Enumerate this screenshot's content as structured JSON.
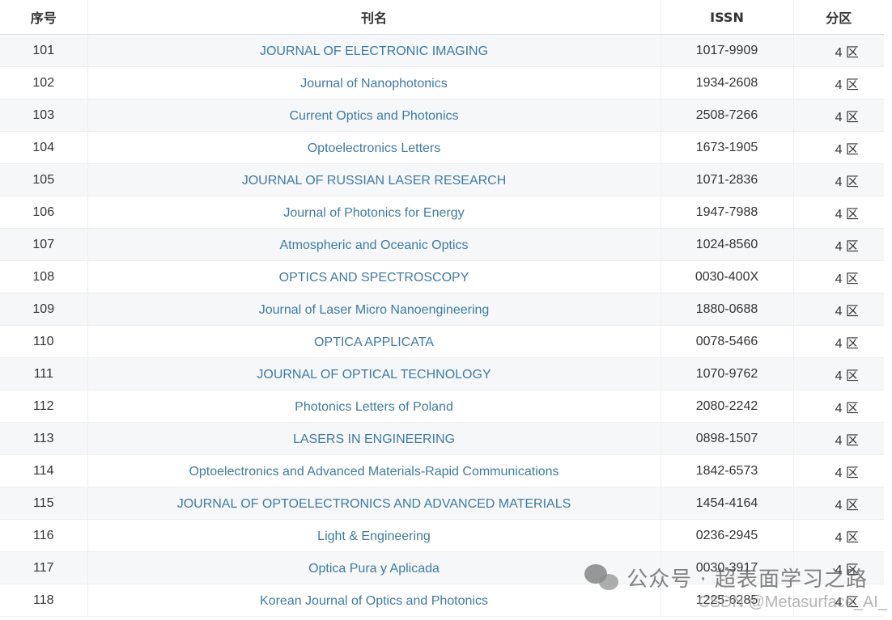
{
  "headers": [
    "序号",
    "刊名",
    "ISSN",
    "分区"
  ],
  "rows": [
    {
      "num": "101",
      "name": "JOURNAL OF ELECTRONIC IMAGING",
      "issn": "1017-9909",
      "zone": "4 区"
    },
    {
      "num": "102",
      "name": "Journal of Nanophotonics",
      "issn": "1934-2608",
      "zone": "4 区"
    },
    {
      "num": "103",
      "name": "Current Optics and Photonics",
      "issn": "2508-7266",
      "zone": "4 区"
    },
    {
      "num": "104",
      "name": "Optoelectronics Letters",
      "issn": "1673-1905",
      "zone": "4 区"
    },
    {
      "num": "105",
      "name": "JOURNAL OF RUSSIAN LASER RESEARCH",
      "issn": "1071-2836",
      "zone": "4 区"
    },
    {
      "num": "106",
      "name": "Journal of Photonics for Energy",
      "issn": "1947-7988",
      "zone": "4 区"
    },
    {
      "num": "107",
      "name": "Atmospheric and Oceanic Optics",
      "issn": "1024-8560",
      "zone": "4 区"
    },
    {
      "num": "108",
      "name": "OPTICS AND SPECTROSCOPY",
      "issn": "0030-400X",
      "zone": "4 区"
    },
    {
      "num": "109",
      "name": "Journal of Laser Micro Nanoengineering",
      "issn": "1880-0688",
      "zone": "4 区"
    },
    {
      "num": "110",
      "name": "OPTICA APPLICATA",
      "issn": "0078-5466",
      "zone": "4 区"
    },
    {
      "num": "111",
      "name": "JOURNAL OF OPTICAL TECHNOLOGY",
      "issn": "1070-9762",
      "zone": "4 区"
    },
    {
      "num": "112",
      "name": "Photonics Letters of Poland",
      "issn": "2080-2242",
      "zone": "4 区"
    },
    {
      "num": "113",
      "name": "LASERS IN ENGINEERING",
      "issn": "0898-1507",
      "zone": "4 区"
    },
    {
      "num": "114",
      "name": "Optoelectronics and Advanced Materials-Rapid Communications",
      "issn": "1842-6573",
      "zone": "4 区"
    },
    {
      "num": "115",
      "name": "JOURNAL OF OPTOELECTRONICS AND ADVANCED MATERIALS",
      "issn": "1454-4164",
      "zone": "4 区"
    },
    {
      "num": "116",
      "name": "Light & Engineering",
      "issn": "0236-2945",
      "zone": "4 区"
    },
    {
      "num": "117",
      "name": "Optica Pura y Aplicada",
      "issn": "0030-3917",
      "zone": "4 区"
    },
    {
      "num": "118",
      "name": "Korean Journal of Optics and Photonics",
      "issn": "1225-6285",
      "zone": "4 区"
    }
  ],
  "watermark": {
    "text": "公众号 · 超表面学习之路",
    "csdn": "CSDN @Metasurface_AI_",
    "icon": "wechat-icon"
  },
  "colors": {
    "link": "#3d7ba6",
    "row_alt": "#f6f7f9",
    "text": "#333333"
  }
}
